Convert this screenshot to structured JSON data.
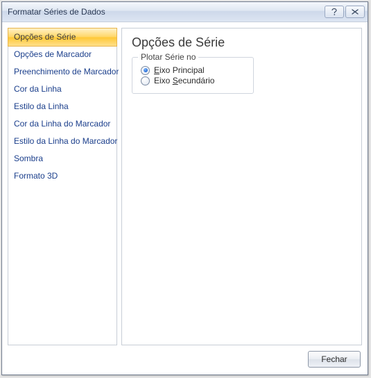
{
  "title": "Formatar Séries de Dados",
  "sidebar": {
    "items": [
      {
        "label": "Opções de Série",
        "selected": true
      },
      {
        "label": "Opções de Marcador",
        "selected": false
      },
      {
        "label": "Preenchimento de Marcador",
        "selected": false
      },
      {
        "label": "Cor da Linha",
        "selected": false
      },
      {
        "label": "Estilo da Linha",
        "selected": false
      },
      {
        "label": "Cor da Linha do Marcador",
        "selected": false
      },
      {
        "label": "Estilo da Linha do Marcador",
        "selected": false
      },
      {
        "label": "Sombra",
        "selected": false
      },
      {
        "label": "Formato 3D",
        "selected": false
      }
    ]
  },
  "content": {
    "heading": "Opções de Série",
    "group_title": "Plotar Série no",
    "radios": [
      {
        "prefix": "E",
        "rest": "ixo Principal",
        "checked": true
      },
      {
        "prefix": "",
        "rest": "Eixo ",
        "mid_ul": "S",
        "rest2": "ecundário",
        "checked": false
      }
    ]
  },
  "footer": {
    "close_label": "Fechar"
  }
}
